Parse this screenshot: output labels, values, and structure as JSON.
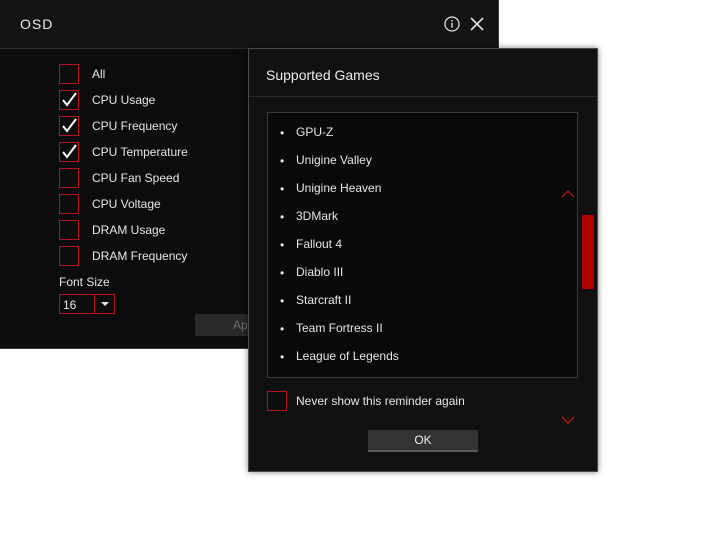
{
  "osd": {
    "title": "OSD",
    "options": [
      {
        "label": "All",
        "checked": false
      },
      {
        "label": "CPU Usage",
        "checked": true
      },
      {
        "label": "CPU Frequency",
        "checked": true
      },
      {
        "label": "CPU Temperature",
        "checked": true
      },
      {
        "label": "CPU Fan Speed",
        "checked": false
      },
      {
        "label": "CPU Voltage",
        "checked": false
      },
      {
        "label": "DRAM Usage",
        "checked": false
      },
      {
        "label": "DRAM Frequency",
        "checked": false
      }
    ],
    "font_size_label": "Font Size",
    "font_size_value": "16",
    "apply_label": "Ap"
  },
  "dialog": {
    "title": "Supported Games",
    "games": [
      "GPU-Z",
      "Unigine Valley",
      "Unigine Heaven",
      "3DMark",
      "Fallout 4",
      "Diablo III",
      "Starcraft II",
      "Team Fortress II",
      "League of Legends"
    ],
    "bullet": "•",
    "never_show_label": "Never show this reminder again",
    "never_show_checked": false,
    "ok_label": "OK"
  },
  "colors": {
    "accent": "#b5141a",
    "scroll_thumb": "#b00000"
  },
  "icons": {
    "info": "info-icon",
    "close": "close-icon",
    "check": "checkmark-icon",
    "dropdown": "chevron-down-icon",
    "scroll_up": "chevron-up-icon",
    "scroll_down": "chevron-down-icon"
  }
}
